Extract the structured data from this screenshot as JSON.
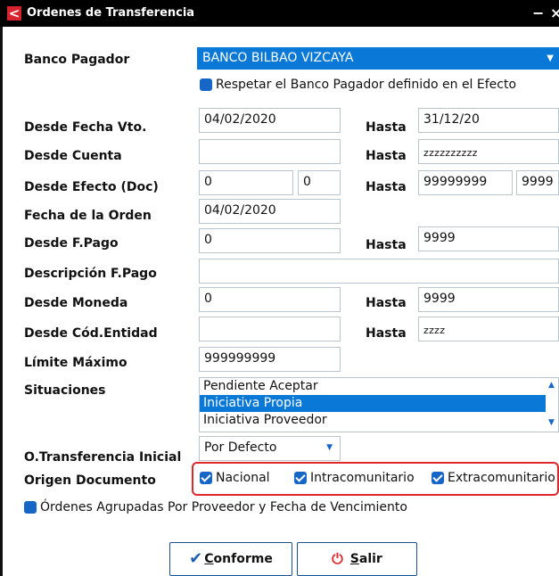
{
  "window": {
    "title": "Ordenes de Transferencia",
    "logo_glyph": "<",
    "minimize_glyph": "−",
    "close_glyph": "×"
  },
  "banco": {
    "label": "Banco Pagador",
    "value": "BANCO BILBAO VIZCAYA",
    "respetar_label": "Respetar el Banco Pagador definido en el Efecto"
  },
  "fecha_vto": {
    "label": "Desde Fecha Vto.",
    "from": "04/02/2020",
    "hasta_label": "Hasta",
    "to": "31/12/20"
  },
  "cuenta": {
    "label": "Desde Cuenta",
    "from": "",
    "hasta_label": "Hasta",
    "to": "zzzzzzzzzz"
  },
  "efecto": {
    "label": "Desde Efecto (Doc)",
    "from_a": "0",
    "from_b": "0",
    "hasta_label": "Hasta",
    "to_a": "99999999",
    "to_b": "9999"
  },
  "fecha_orden": {
    "label": "Fecha de la Orden",
    "value": "04/02/2020"
  },
  "fpago": {
    "label": "Desde F.Pago",
    "from": "0",
    "hasta_label": "Hasta",
    "to": "9999"
  },
  "desc_fpago": {
    "label": "Descripción F.Pago",
    "value": ""
  },
  "moneda": {
    "label": "Desde Moneda",
    "from": "0",
    "hasta_label": "Hasta",
    "to": "9999"
  },
  "entidad": {
    "label": "Desde Cód.Entidad",
    "from": "",
    "hasta_label": "Hasta",
    "to": "zzzz"
  },
  "limite": {
    "label": "Límite Máximo",
    "value": "999999999"
  },
  "situaciones": {
    "label": "Situaciones",
    "items": [
      "Pendiente Aceptar",
      "Iniciativa Propia",
      "Iniciativa Proveedor"
    ],
    "selected_index": 1
  },
  "otransferencia": {
    "label": "O.Transferencia Inicial",
    "value": "Por Defecto"
  },
  "origen": {
    "label": "Origen Documento",
    "options": [
      {
        "label": "Nacional",
        "checked": true
      },
      {
        "label": "Intracomunitario",
        "checked": true
      },
      {
        "label": "Extracomunitario",
        "checked": true
      }
    ]
  },
  "agrupadas_label": "Órdenes Agrupadas Por Proveedor y Fecha de Vencimiento",
  "buttons": {
    "conforme_first": "C",
    "conforme_rest": "onforme",
    "salir_first": "S",
    "salir_rest": "alir"
  },
  "icons": {
    "conforme": "check-icon",
    "salir": "power-icon",
    "combo": "chevron-down-icon"
  },
  "colors": {
    "selection": "#0a78d7",
    "checkbox": "#1566c7",
    "highlight_border": "#e0272b",
    "title_bar": "#000000"
  }
}
